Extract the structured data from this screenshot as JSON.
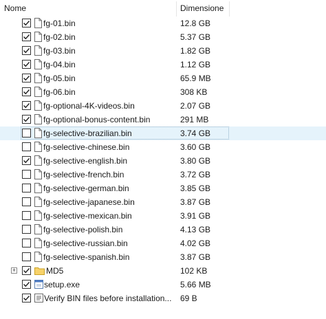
{
  "columns": {
    "name": "Nome",
    "size": "Dimensione"
  },
  "rows": [
    {
      "name": "fg-01.bin",
      "size": "12.8 GB",
      "checked": true
    },
    {
      "name": "fg-02.bin",
      "size": "5.37 GB",
      "checked": true
    },
    {
      "name": "fg-03.bin",
      "size": "1.82 GB",
      "checked": true
    },
    {
      "name": "fg-04.bin",
      "size": "1.12 GB",
      "checked": true
    },
    {
      "name": "fg-05.bin",
      "size": "65.9 MB",
      "checked": true
    },
    {
      "name": "fg-06.bin",
      "size": "308 KB",
      "checked": true
    },
    {
      "name": "fg-optional-4K-videos.bin",
      "size": "2.07 GB",
      "checked": true
    },
    {
      "name": "fg-optional-bonus-content.bin",
      "size": "291 MB",
      "checked": true
    },
    {
      "name": "fg-selective-brazilian.bin",
      "size": "3.74 GB",
      "checked": false,
      "selected": true
    },
    {
      "name": "fg-selective-chinese.bin",
      "size": "3.60 GB",
      "checked": false
    },
    {
      "name": "fg-selective-english.bin",
      "size": "3.80 GB",
      "checked": true
    },
    {
      "name": "fg-selective-french.bin",
      "size": "3.72 GB",
      "checked": false
    },
    {
      "name": "fg-selective-german.bin",
      "size": "3.85 GB",
      "checked": false
    },
    {
      "name": "fg-selective-japanese.bin",
      "size": "3.87 GB",
      "checked": false
    },
    {
      "name": "fg-selective-mexican.bin",
      "size": "3.91 GB",
      "checked": false
    },
    {
      "name": "fg-selective-polish.bin",
      "size": "4.13 GB",
      "checked": false
    },
    {
      "name": "fg-selective-russian.bin",
      "size": "4.02 GB",
      "checked": false
    },
    {
      "name": "fg-selective-spanish.bin",
      "size": "3.87 GB",
      "checked": false
    }
  ],
  "folder": {
    "name": "MD5",
    "size": "102 KB",
    "checked": true,
    "expander": "+"
  },
  "extra_rows": [
    {
      "name": "setup.exe",
      "size": "5.66 MB",
      "checked": true,
      "icon": "exe-icon"
    },
    {
      "name": "Verify BIN files before installation...",
      "size": "69 B",
      "checked": true,
      "icon": "script-icon"
    }
  ],
  "colors": {
    "selection": "#e5f3fb",
    "folder": "#f7d26a"
  }
}
